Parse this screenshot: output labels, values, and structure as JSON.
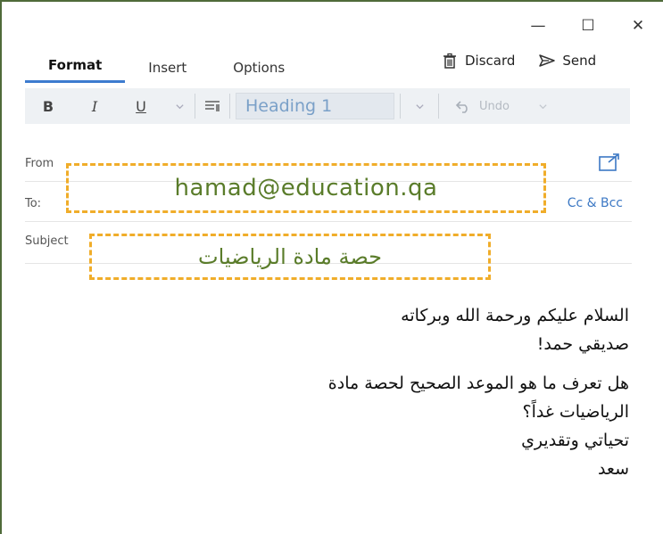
{
  "window": {
    "controls": {
      "minimize": "—",
      "maximize": "☐",
      "close": "✕"
    }
  },
  "tabs": [
    {
      "label": "Format",
      "active": true
    },
    {
      "label": "Insert",
      "active": false
    },
    {
      "label": "Options",
      "active": false
    }
  ],
  "actions": {
    "discard": "Discard",
    "send": "Send"
  },
  "toolbar": {
    "bold": "B",
    "italic": "I",
    "underline": "U",
    "style": "Heading 1",
    "undo": "Undo"
  },
  "fields": {
    "from_label": "From",
    "to_label": "To:",
    "subject_label": "Subject",
    "cc_bcc": "Cc & Bcc"
  },
  "callouts": {
    "email": "hamad@education.qa",
    "subject": "حصة مادة الرياضيات"
  },
  "body_lines": [
    "السلام عليكم ورحمة الله وبركاته",
    "صديقي حمد!",
    "هل تعرف ما هو الموعد الصحيح لحصة مادة",
    "الرياضيات غداً؟",
    "تحياتي وتقديري",
    "سعد"
  ],
  "colors": {
    "accent": "#3d7ccf",
    "callout_border": "#f0ad2a",
    "callout_text": "#5a7c2a",
    "heading_text": "#7aa0c8"
  }
}
